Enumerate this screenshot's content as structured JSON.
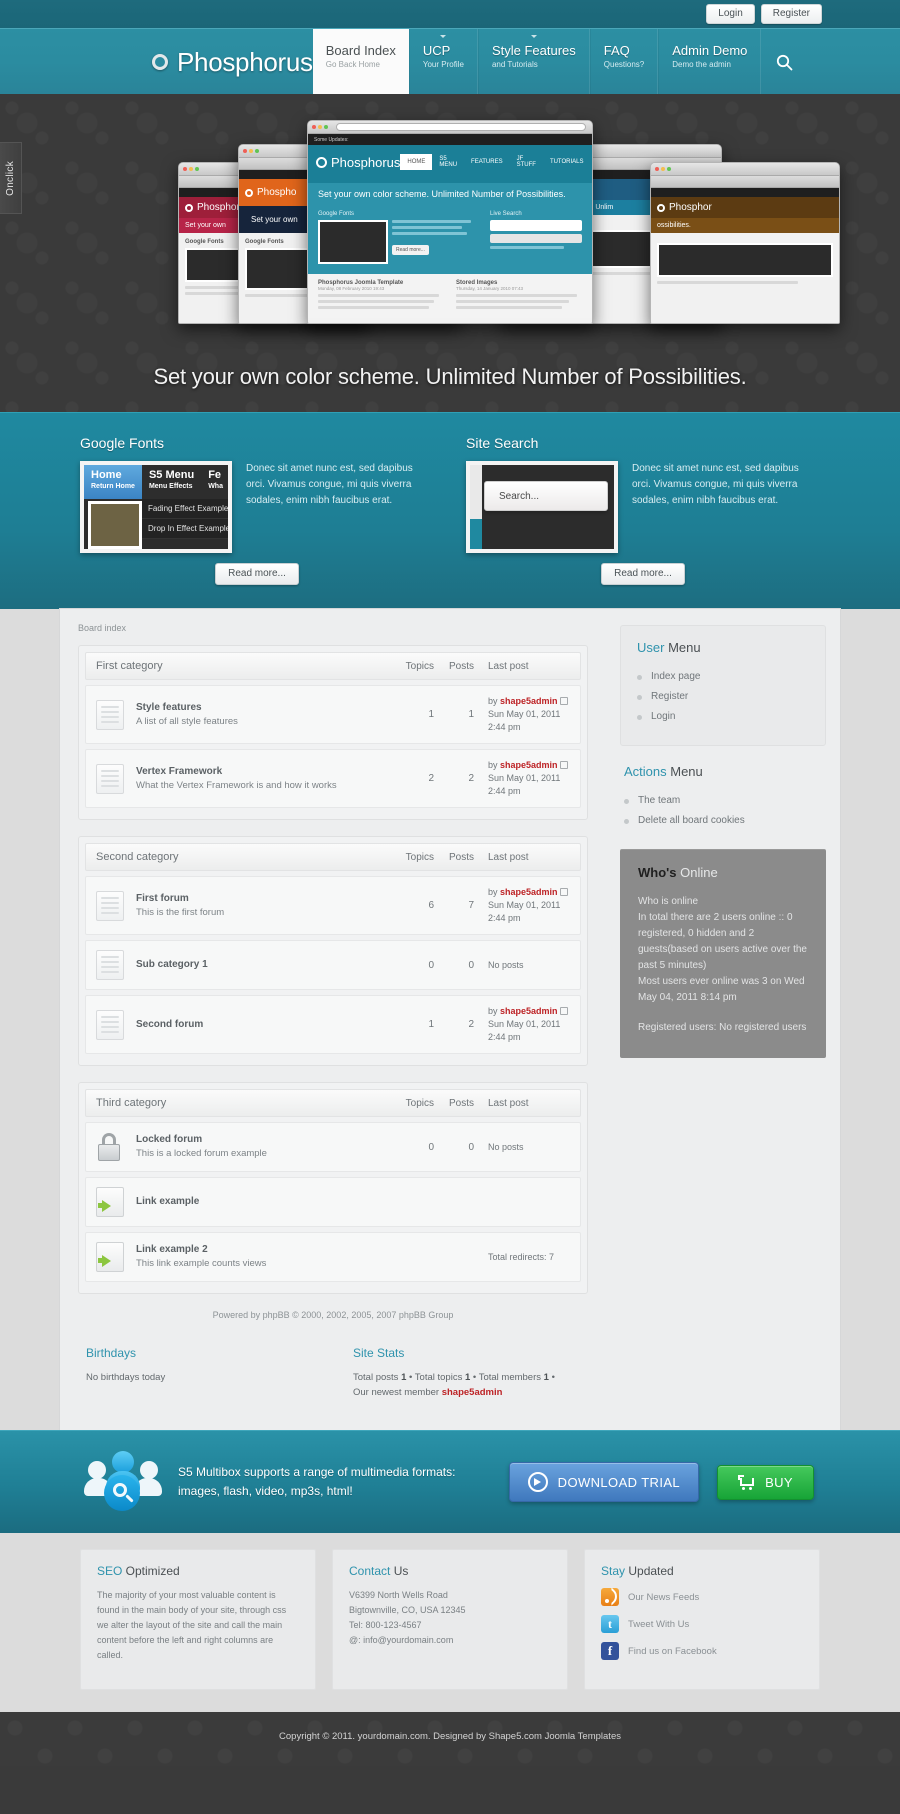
{
  "topbar": {
    "login": "Login",
    "register": "Register"
  },
  "header": {
    "logo": "Phosphorus",
    "nav": [
      {
        "title": "Board Index",
        "sub": "Go Back Home",
        "active": true,
        "arrow": false
      },
      {
        "title": "UCP",
        "sub": "Your Profile",
        "active": false,
        "arrow": true
      },
      {
        "title": "Style Features",
        "sub": "and Tutorials",
        "active": false,
        "arrow": true
      },
      {
        "title": "FAQ",
        "sub": "Questions?",
        "active": false,
        "arrow": false
      },
      {
        "title": "Admin Demo",
        "sub": "Demo the admin",
        "active": false,
        "arrow": false
      }
    ],
    "search_icon": "search-icon"
  },
  "hero": {
    "onclick_tab": "Onclick",
    "caption": "Set your own color scheme. Unlimited Number of Possibilities.",
    "window_brand": "Phosphorus",
    "window_tagline": "Set your own color scheme. Unlimited Number of Possibilities.",
    "window_panel_left": "Google Fonts",
    "window_panel_right": "Live Search",
    "window_article_1": "Phosphorus Joomla Template",
    "window_article_1_date": "Monday, 08 February 2010 19:43",
    "window_article_2": "Stored Images",
    "window_article_2_date": "Thursday, 14 January 2010 07:43"
  },
  "features": [
    {
      "title": "Google Fonts",
      "text": "Donec sit amet nunc est, sed dapibus orci. Vivamus congue, mi quis viverra sodales, enim nibh faucibus erat.",
      "readmore": "Read more...",
      "demo": {
        "item1_title": "Home",
        "item1_sub": "Return Home",
        "item2_title": "S5 Menu",
        "item2_sub": "Menu Effects",
        "item3_title": "Fe",
        "item3_sub": "Wha",
        "drop1": "Fading Effect Example",
        "drop2": "Drop In Effect Example"
      }
    },
    {
      "title": "Site Search",
      "text": "Donec sit amet nunc est, sed dapibus orci. Vivamus congue, mi quis viverra sodales, enim nibh faucibus erat.",
      "readmore": "Read more...",
      "search_placeholder": "Search..."
    }
  ],
  "board": {
    "breadcrumb": "Board index",
    "columns": {
      "topics": "Topics",
      "posts": "Posts",
      "last_post": "Last post"
    },
    "categories": [
      {
        "name": "First category",
        "show_columns": true,
        "forums": [
          {
            "icon": "forum-icon",
            "name": "Style features",
            "desc": "A list of all style features",
            "topics": "1",
            "posts": "1",
            "last_by": "by",
            "last_author": "shape5admin",
            "last_date": "Sun May 01, 2011 2:44 pm"
          },
          {
            "icon": "forum-icon",
            "name": "Vertex Framework",
            "desc": "What the Vertex Framework is and how it works",
            "topics": "2",
            "posts": "2",
            "last_by": "by",
            "last_author": "shape5admin",
            "last_date": "Sun May 01, 2011 2:44 pm"
          }
        ]
      },
      {
        "name": "Second category",
        "show_columns": true,
        "forums": [
          {
            "icon": "forum-icon",
            "name": "First forum",
            "desc": "This is the first forum",
            "topics": "6",
            "posts": "7",
            "last_by": "by",
            "last_author": "shape5admin",
            "last_date": "Sun May 01, 2011 2:44 pm"
          },
          {
            "icon": "forum-icon",
            "name": "Sub category 1",
            "desc": "",
            "topics": "0",
            "posts": "0",
            "last_noposts": "No posts"
          },
          {
            "icon": "forum-icon",
            "name": "Second forum",
            "desc": "",
            "topics": "1",
            "posts": "2",
            "last_by": "by",
            "last_author": "shape5admin",
            "last_date": "Sun May 01, 2011 2:44 pm"
          }
        ]
      },
      {
        "name": "Third category",
        "show_columns": true,
        "forums": [
          {
            "icon": "lock-icon",
            "name": "Locked forum",
            "desc": "This is a locked forum example",
            "topics": "0",
            "posts": "0",
            "last_noposts": "No posts"
          },
          {
            "icon": "link-icon",
            "name": "Link example",
            "desc": "",
            "topics": "",
            "posts": "",
            "last_noposts": ""
          },
          {
            "icon": "link-icon",
            "name": "Link example 2",
            "desc": "This link example counts views",
            "topics": "",
            "posts": "",
            "last_noposts": "Total redirects: 7"
          }
        ]
      }
    ],
    "powered": "Powered by phpBB © 2000, 2002, 2005, 2007 phpBB Group",
    "birthdays": {
      "title": "Birthdays",
      "text": "No birthdays today"
    },
    "site_stats": {
      "title": "Site Stats",
      "line1_a": "Total posts ",
      "line1_b": "1",
      "line1_c": " • Total topics ",
      "line1_d": "1",
      "line1_e": " • Total members ",
      "line1_f": "1",
      "line1_g": " • ",
      "line2_a": "Our newest member ",
      "line2_member": "shape5admin"
    }
  },
  "sidebar": {
    "user_menu": {
      "title_hl": "User",
      "title_rest": " Menu",
      "items": [
        "Index page",
        "Register",
        "Login"
      ]
    },
    "actions_menu": {
      "title_hl": "Actions",
      "title_rest": " Menu",
      "items": [
        "The team",
        "Delete all board cookies"
      ]
    },
    "whos_online": {
      "title_hl": "Who's",
      "title_rest": " Online",
      "para1": "Who is online\nIn total there are 2 users online :: 0 registered, 0 hidden and 2 guests(based on users active over the past 5 minutes)\nMost users ever online was 3 on Wed May 04, 2011 8:14 pm",
      "para2": "Registered users: No registered users"
    }
  },
  "promo": {
    "text": "S5 Multibox supports a range of multimedia formats: images, flash, video, mp3s, html!",
    "download_label": "DOWNLOAD TRIAL",
    "buy_label": "BUY"
  },
  "footer_modules": [
    {
      "title_hl": "SEO",
      "title_rest": " Optimized",
      "text": "The majority of your most valuable content is found in the main body of your site, through css we alter the layout of the site and call the main content before the left and right columns are called."
    },
    {
      "title_hl": "Contact",
      "title_rest": " Us",
      "text": "V6399 North Wells Road\nBigtownville, CO, USA 12345\nTel: 800-123-4567\n@: info@yourdomain.com"
    }
  ],
  "stay_updated": {
    "title_hl": "Stay",
    "title_rest": " Updated",
    "links": [
      {
        "icon": "rss-icon",
        "label": "Our News Feeds"
      },
      {
        "icon": "twitter-icon",
        "label": "Tweet With Us"
      },
      {
        "icon": "facebook-icon",
        "label": "Find us on Facebook"
      }
    ]
  },
  "copyright": "Copyright © 2011. yourdomain.com. Designed by Shape5.com Joomla Templates"
}
